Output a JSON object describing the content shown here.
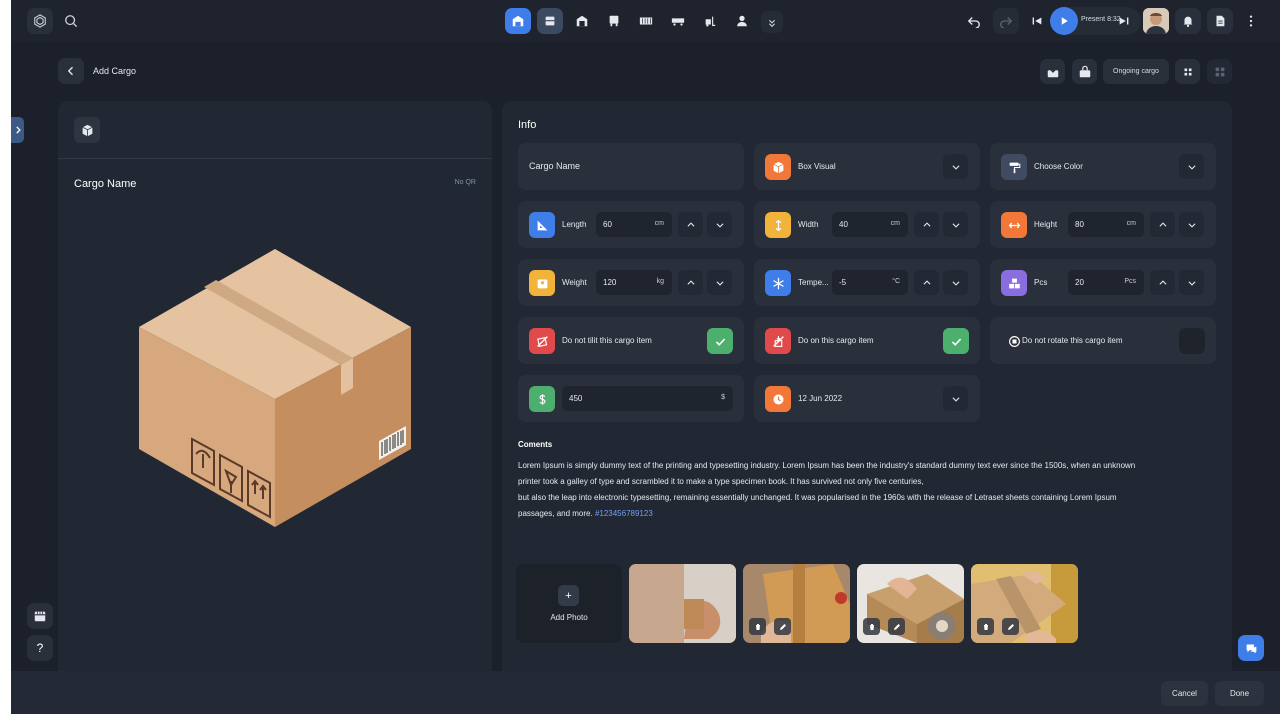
{
  "header": {
    "present_label": "Present 8:32"
  },
  "page": {
    "title": "Add Cargo",
    "ongoing_label": "Ongoing cargo"
  },
  "left_panel": {
    "cargo_name": "Cargo Name",
    "qr_status": "No QR"
  },
  "info": {
    "title": "Info",
    "cargo_name_label": "Cargo Name",
    "box_visual_label": "Box Visual",
    "choose_color_label": "Choose Color",
    "length": {
      "label": "Length",
      "value": "60",
      "unit": "cm"
    },
    "width": {
      "label": "Width",
      "value": "40",
      "unit": "cm"
    },
    "height": {
      "label": "Height",
      "value": "80",
      "unit": "cm"
    },
    "weight": {
      "label": "Weight",
      "value": "120",
      "unit": "kg"
    },
    "temperature": {
      "label": "Tempe...",
      "value": "-5",
      "unit": "°C"
    },
    "pcs": {
      "label": "Pcs",
      "value": "20",
      "unit": "Pcs"
    },
    "no_tilt": {
      "label": "Do not tilit this cargo item",
      "checked": true
    },
    "no_on": {
      "label": "Do on this cargo item",
      "checked": true
    },
    "no_rotate": {
      "label": "Do not  rotate this cargo item",
      "checked": false
    },
    "price": {
      "value": "450",
      "unit": "$"
    },
    "date": "12 Jun 2022"
  },
  "comments": {
    "title": "Coments",
    "line1": "Lorem Ipsum is simply dummy text of the printing and typesetting industry. Lorem Ipsum has been the industry's standard dummy text ever since the 1500s, when an unknown",
    "line2": "printer took a galley of type and scrambled it to make a type specimen book. It has survived not only five centuries,",
    "line3": "but also the leap into electronic typesetting, remaining essentially unchanged. It was popularised in the 1960s with the release of Letraset sheets containing Lorem Ipsum",
    "line4": "passages, and more. ",
    "tag": "#123456789123"
  },
  "photos": {
    "add_label": "Add Photo",
    "add_symbol": "+"
  },
  "footer": {
    "cancel": "Cancel",
    "done": "Done"
  },
  "help_symbol": "?",
  "colors": {
    "accent": "#3f7ee8",
    "green": "#4caf6e",
    "red": "#e04a4a",
    "orange": "#f2783a",
    "yellow": "#f2b33a",
    "purple": "#8a6ee0"
  }
}
